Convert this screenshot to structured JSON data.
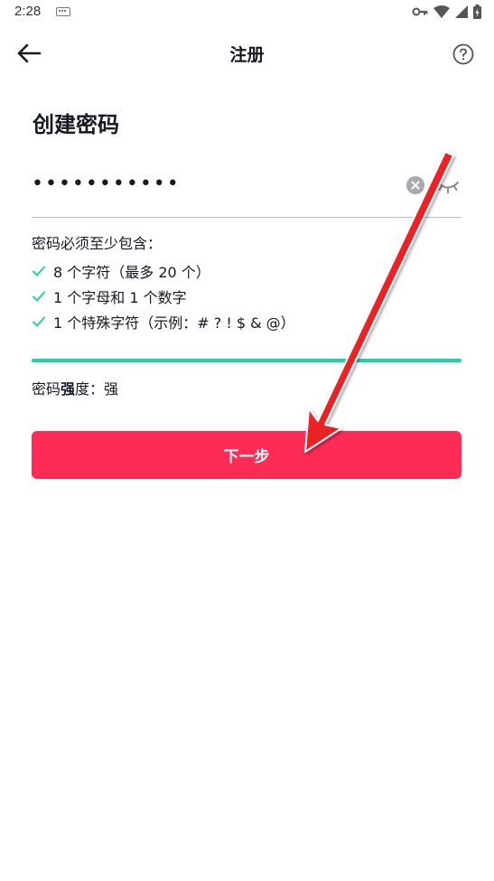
{
  "status_bar": {
    "time": "2:28",
    "icons": [
      "keyboard-icon",
      "vpn-key-icon",
      "wifi-icon",
      "signal-icon",
      "battery-icon"
    ]
  },
  "header": {
    "title": "注册",
    "back_icon": "arrow-left-icon",
    "help_icon": "question-circle-icon"
  },
  "form": {
    "heading": "创建密码",
    "password_mask": "•••••••••••",
    "clear_icon": "clear-x-icon",
    "visibility_icon": "eye-closed-icon",
    "requirements_title": "密码必须至少包含：",
    "requirements": [
      {
        "text": "8 个字符（最多 20 个）",
        "met": true
      },
      {
        "text": "1 个字母和 1 个数字",
        "met": true
      },
      {
        "text": "1 个特殊字符（示例：# ? ! $ & @）",
        "met": true
      }
    ],
    "strength_label_prefix": "密码",
    "strength_label_bold": "强",
    "strength_label_suffix": "度：",
    "strength_value": "强",
    "strength_level": 1.0,
    "next_button": "下一步"
  },
  "colors": {
    "accent": "#fe2c55",
    "success": "#1fd3a0",
    "annotation_arrow": "#e8141c"
  }
}
